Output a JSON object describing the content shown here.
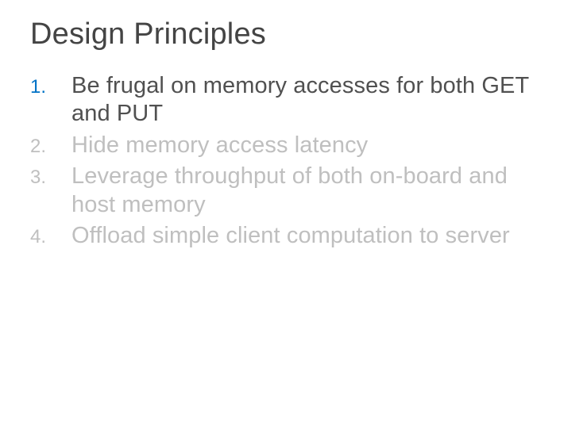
{
  "title": "Design Principles",
  "items": [
    {
      "num": "1.",
      "text": "Be frugal on memory accesses for both GET and PUT",
      "highlight": true
    },
    {
      "num": "2.",
      "text": "Hide memory access latency",
      "highlight": false
    },
    {
      "num": "3.",
      "text": "Leverage throughput of both on-board and host memory",
      "highlight": false
    },
    {
      "num": "4.",
      "text": "Offload simple client computation to server",
      "highlight": false
    }
  ]
}
